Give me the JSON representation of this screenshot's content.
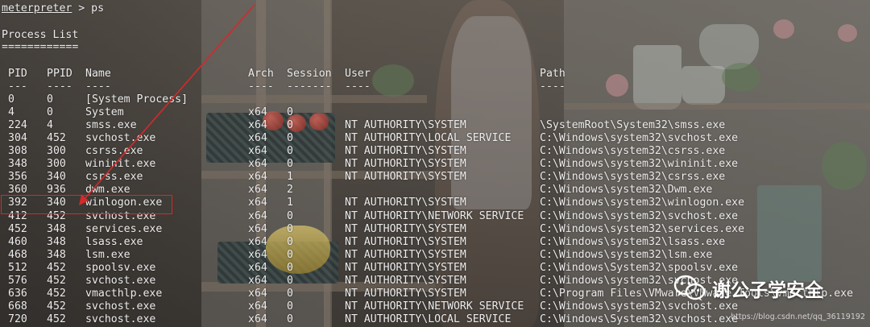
{
  "terminal": {
    "prompt": {
      "shell": "meterpreter",
      "symbol": " > ",
      "command": "ps"
    },
    "section_title": "Process List",
    "section_rule": "============",
    "columns": {
      "pid": "PID",
      "ppid": "PPID",
      "name": "Name",
      "arch": "Arch",
      "session": "Session",
      "user": "User",
      "path": "Path"
    },
    "separators": {
      "pid": "---",
      "ppid": "----",
      "name": "----",
      "arch": "----",
      "session": "-------",
      "user": "----",
      "path": "----"
    },
    "processes": [
      {
        "pid": "0",
        "ppid": "0",
        "name": "[System Process]",
        "arch": "",
        "session": "",
        "user": "",
        "path": ""
      },
      {
        "pid": "4",
        "ppid": "0",
        "name": "System",
        "arch": "x64",
        "session": "0",
        "user": "",
        "path": ""
      },
      {
        "pid": "224",
        "ppid": "4",
        "name": "smss.exe",
        "arch": "x64",
        "session": "0",
        "user": "NT AUTHORITY\\SYSTEM",
        "path": "\\SystemRoot\\System32\\smss.exe"
      },
      {
        "pid": "304",
        "ppid": "452",
        "name": "svchost.exe",
        "arch": "x64",
        "session": "0",
        "user": "NT AUTHORITY\\LOCAL SERVICE",
        "path": "C:\\Windows\\system32\\svchost.exe"
      },
      {
        "pid": "308",
        "ppid": "300",
        "name": "csrss.exe",
        "arch": "x64",
        "session": "0",
        "user": "NT AUTHORITY\\SYSTEM",
        "path": "C:\\Windows\\system32\\csrss.exe"
      },
      {
        "pid": "348",
        "ppid": "300",
        "name": "wininit.exe",
        "arch": "x64",
        "session": "0",
        "user": "NT AUTHORITY\\SYSTEM",
        "path": "C:\\Windows\\system32\\wininit.exe"
      },
      {
        "pid": "356",
        "ppid": "340",
        "name": "csrss.exe",
        "arch": "x64",
        "session": "1",
        "user": "NT AUTHORITY\\SYSTEM",
        "path": "C:\\Windows\\system32\\csrss.exe"
      },
      {
        "pid": "360",
        "ppid": "936",
        "name": "dwm.exe",
        "arch": "x64",
        "session": "2",
        "user": "",
        "path": "C:\\Windows\\system32\\Dwm.exe"
      },
      {
        "pid": "392",
        "ppid": "340",
        "name": "winlogon.exe",
        "arch": "x64",
        "session": "1",
        "user": "NT AUTHORITY\\SYSTEM",
        "path": "C:\\Windows\\system32\\winlogon.exe"
      },
      {
        "pid": "412",
        "ppid": "452",
        "name": "svchost.exe",
        "arch": "x64",
        "session": "0",
        "user": "NT AUTHORITY\\NETWORK SERVICE",
        "path": "C:\\Windows\\system32\\svchost.exe"
      },
      {
        "pid": "452",
        "ppid": "348",
        "name": "services.exe",
        "arch": "x64",
        "session": "0",
        "user": "NT AUTHORITY\\SYSTEM",
        "path": "C:\\Windows\\system32\\services.exe"
      },
      {
        "pid": "460",
        "ppid": "348",
        "name": "lsass.exe",
        "arch": "x64",
        "session": "0",
        "user": "NT AUTHORITY\\SYSTEM",
        "path": "C:\\Windows\\system32\\lsass.exe"
      },
      {
        "pid": "468",
        "ppid": "348",
        "name": "lsm.exe",
        "arch": "x64",
        "session": "0",
        "user": "NT AUTHORITY\\SYSTEM",
        "path": "C:\\Windows\\system32\\lsm.exe"
      },
      {
        "pid": "512",
        "ppid": "452",
        "name": "spoolsv.exe",
        "arch": "x64",
        "session": "0",
        "user": "NT AUTHORITY\\SYSTEM",
        "path": "C:\\Windows\\System32\\spoolsv.exe"
      },
      {
        "pid": "576",
        "ppid": "452",
        "name": "svchost.exe",
        "arch": "x64",
        "session": "0",
        "user": "NT AUTHORITY\\SYSTEM",
        "path": "C:\\Windows\\system32\\svchost.exe"
      },
      {
        "pid": "636",
        "ppid": "452",
        "name": "vmacthlp.exe",
        "arch": "x64",
        "session": "0",
        "user": "NT AUTHORITY\\SYSTEM",
        "path": "C:\\Program Files\\VMware\\VMware Tools\\vmacthlp.exe"
      },
      {
        "pid": "668",
        "ppid": "452",
        "name": "svchost.exe",
        "arch": "x64",
        "session": "0",
        "user": "NT AUTHORITY\\NETWORK SERVICE",
        "path": "C:\\Windows\\system32\\svchost.exe"
      },
      {
        "pid": "720",
        "ppid": "452",
        "name": "svchost.exe",
        "arch": "x64",
        "session": "0",
        "user": "NT AUTHORITY\\LOCAL SERVICE",
        "path": "C:\\Windows\\System32\\svchost.exe"
      }
    ]
  },
  "highlight": {
    "target_name": "winlogon.exe",
    "color": "#d42a2a"
  },
  "watermark": {
    "icon": "wechat-icon",
    "account_name": "谢公子学安全",
    "url": "https://blog.csdn.net/qq_36119192"
  }
}
